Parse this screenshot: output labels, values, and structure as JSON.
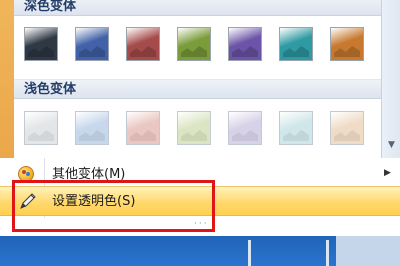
{
  "gallery": {
    "dark_header": "深色变体",
    "light_header": "浅色变体",
    "dark_swatches": [
      {
        "name": "dark-grayscale",
        "color": "#2f3845"
      },
      {
        "name": "dark-blue",
        "color": "#4162a8"
      },
      {
        "name": "dark-red",
        "color": "#a64b4b"
      },
      {
        "name": "dark-green",
        "color": "#7a9c3a"
      },
      {
        "name": "dark-purple",
        "color": "#6c55a8"
      },
      {
        "name": "dark-teal",
        "color": "#2e9aa3"
      },
      {
        "name": "dark-orange",
        "color": "#c77a2f"
      }
    ],
    "light_swatches": [
      {
        "name": "light-grayscale",
        "color": "#e3e6e8"
      },
      {
        "name": "light-blue",
        "color": "#c8d8ec"
      },
      {
        "name": "light-red",
        "color": "#eac7c2"
      },
      {
        "name": "light-green",
        "color": "#dce5c3"
      },
      {
        "name": "light-purple",
        "color": "#d8d2e8"
      },
      {
        "name": "light-teal",
        "color": "#cfe7ea"
      },
      {
        "name": "light-orange",
        "color": "#f0dcc6"
      }
    ]
  },
  "menu": {
    "more_variations": "其他变体(M)",
    "set_transparent_color": "设置透明色(S)"
  },
  "colors": {
    "highlight_box": "#e01515",
    "hover_fill": "#ffd96e"
  }
}
